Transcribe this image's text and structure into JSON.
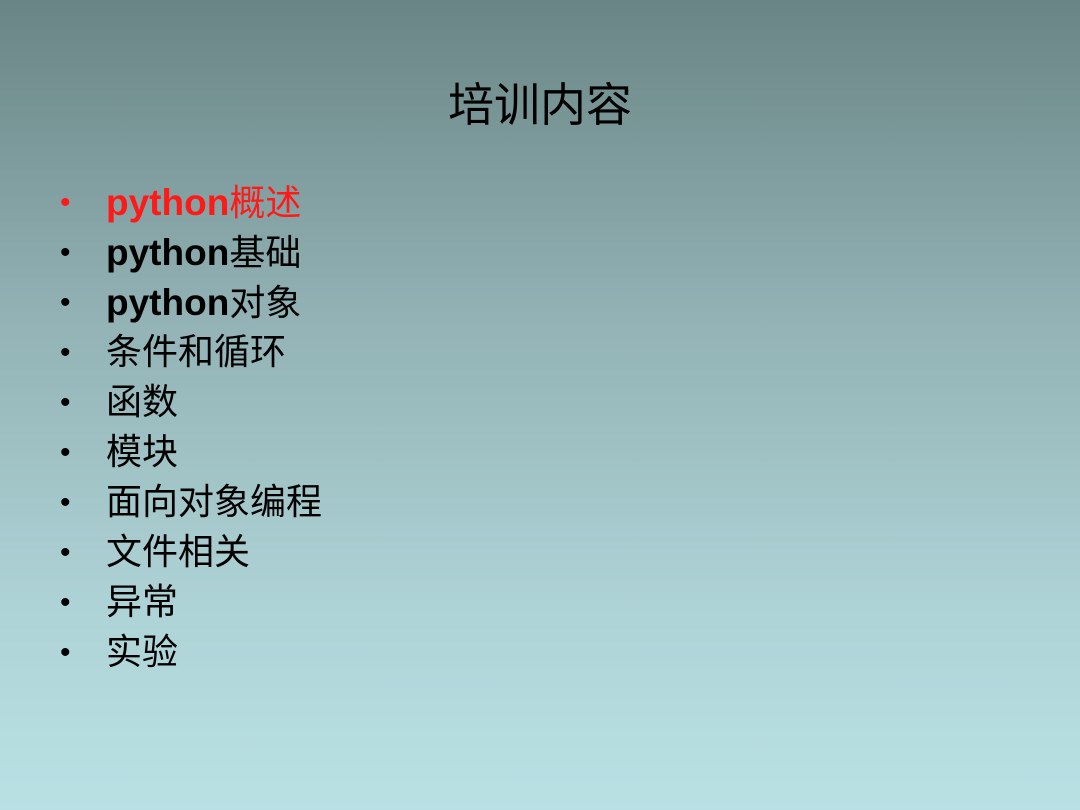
{
  "slide": {
    "title": "培训内容",
    "highlight_color": "#ff1a1a",
    "bullet_symbol": "•",
    "items": [
      {
        "latin": "python",
        "cjk": "概述",
        "highlighted": true
      },
      {
        "latin": "python",
        "cjk": "基础",
        "highlighted": false
      },
      {
        "latin": "python",
        "cjk": "对象",
        "highlighted": false
      },
      {
        "latin": "",
        "cjk": "条件和循环",
        "highlighted": false
      },
      {
        "latin": "",
        "cjk": "函数",
        "highlighted": false
      },
      {
        "latin": "",
        "cjk": "模块",
        "highlighted": false
      },
      {
        "latin": "",
        "cjk": "面向对象编程",
        "highlighted": false
      },
      {
        "latin": "",
        "cjk": "文件相关",
        "highlighted": false
      },
      {
        "latin": "",
        "cjk": "异常",
        "highlighted": false
      },
      {
        "latin": "",
        "cjk": "实验",
        "highlighted": false
      }
    ]
  }
}
